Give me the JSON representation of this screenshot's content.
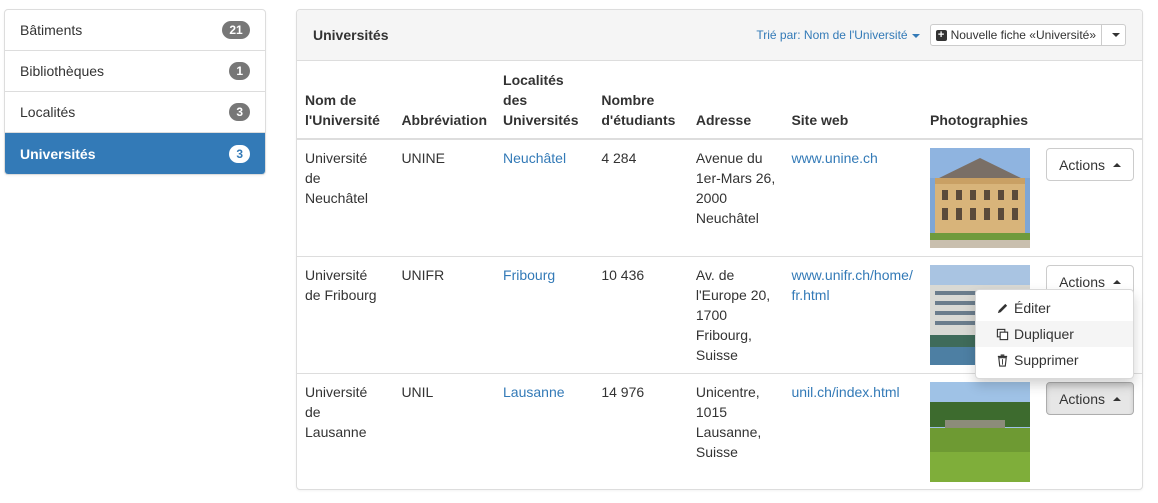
{
  "sidebar": {
    "items": [
      {
        "label": "Bâtiments",
        "count": "21"
      },
      {
        "label": "Bibliothèques",
        "count": "1"
      },
      {
        "label": "Localités",
        "count": "3"
      },
      {
        "label": "Universités",
        "count": "3",
        "active": true
      }
    ]
  },
  "panel": {
    "title": "Universités",
    "sort_label": "Trié par: Nom de l'Université",
    "new_button_label": "Nouvelle fiche «Université»"
  },
  "table": {
    "headers": {
      "name": "Nom de l'Université",
      "abbr": "Abbréviation",
      "locality": "Localités des Universités",
      "students": "Nombre d'étudiants",
      "address": "Adresse",
      "website": "Site web",
      "photos": "Photographies"
    },
    "rows": [
      {
        "name": "Université de Neuchâtel",
        "abbr": "UNINE",
        "locality": "Neuchâtel",
        "students": "4 284",
        "address": "Avenue du 1er-Mars 26, 2000 Neuchâtel",
        "website": "www.unine.ch",
        "actions_label": "Actions"
      },
      {
        "name": "Université de Fribourg",
        "abbr": "UNIFR",
        "locality": "Fribourg",
        "students": "10 436",
        "address": "Av. de l'Europe 20, 1700 Fribourg, Suisse",
        "website": "www.unifr.ch/home/fr.html",
        "actions_label": "Actions"
      },
      {
        "name": "Université de Lausanne",
        "abbr": "UNIL",
        "locality": "Lausanne",
        "students": "14 976",
        "address": "Unicentre, 1015 Lausanne, Suisse",
        "website": "unil.ch/index.html",
        "actions_label": "Actions"
      }
    ]
  },
  "dropdown": {
    "items": [
      {
        "label": "Éditer",
        "icon": "pencil-icon"
      },
      {
        "label": "Dupliquer",
        "icon": "copy-icon"
      },
      {
        "label": "Supprimer",
        "icon": "trash-icon"
      }
    ]
  },
  "colors": {
    "accent": "#337ab7",
    "badge": "#777777",
    "heading_bg": "#f5f5f5"
  }
}
